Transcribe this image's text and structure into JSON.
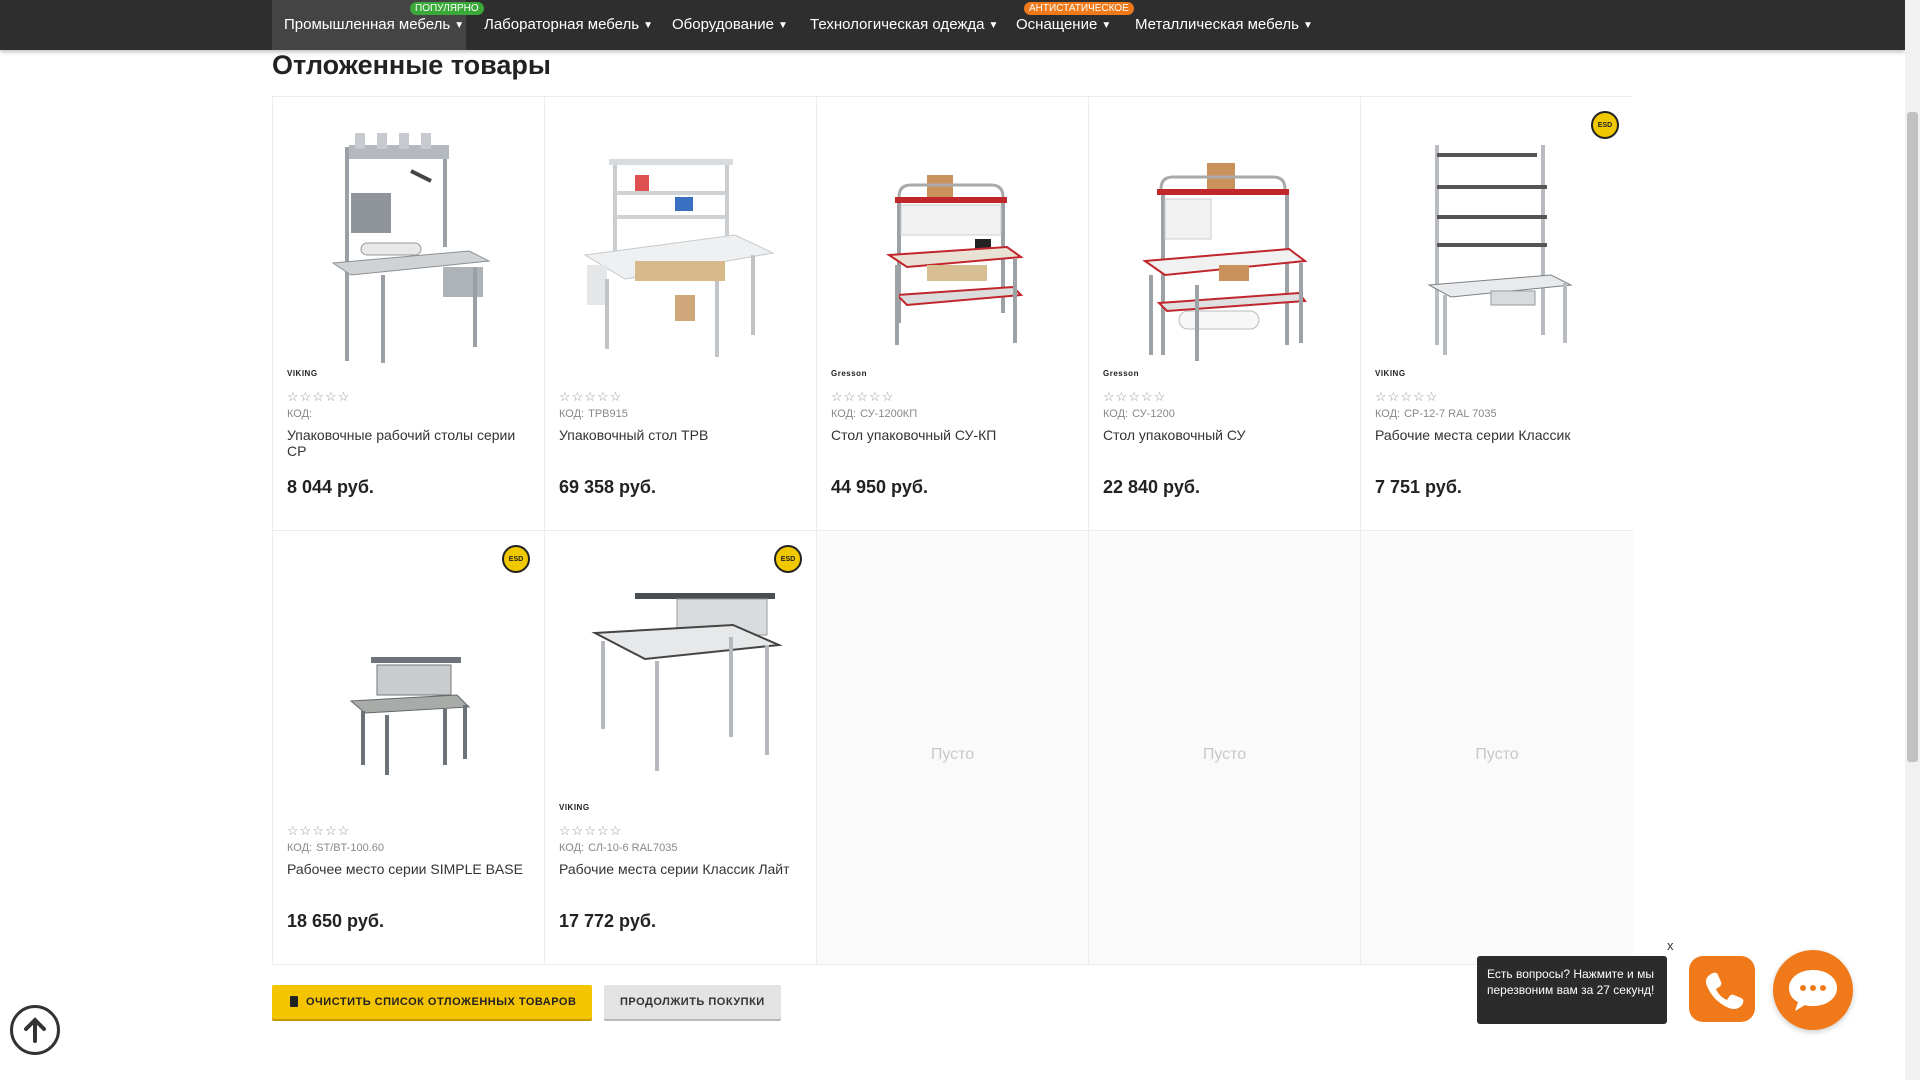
{
  "nav": {
    "items": [
      {
        "label": "Промышленная мебель",
        "badge": "ПОПУЛЯРНО",
        "badge_color": "#3aa93a"
      },
      {
        "label": "Лабораторная мебель",
        "badge": "",
        "badge_color": ""
      },
      {
        "label": "Оборудование",
        "badge": "",
        "badge_color": ""
      },
      {
        "label": "Технологическая одежда",
        "badge": "",
        "badge_color": ""
      },
      {
        "label": "Оснащение",
        "badge": "АНТИСТАТИЧЕСКОЕ",
        "badge_color": "#f07a1a"
      },
      {
        "label": "Металлическая мебель",
        "badge": "",
        "badge_color": ""
      }
    ]
  },
  "page": {
    "title": "Отложенные товары"
  },
  "products": [
    {
      "brand": "VIKING",
      "code_label": "КОД:",
      "code": "",
      "name": "Упаковочные рабочий столы серии СР",
      "price": "8 044 руб.",
      "esd": false,
      "stars": "☆☆☆☆☆"
    },
    {
      "brand": "",
      "code_label": "КОД:",
      "code": "TPB915",
      "name": "Упаковочный стол ТРВ",
      "price": "69 358 руб.",
      "esd": false,
      "stars": "☆☆☆☆☆"
    },
    {
      "brand": "Gresson",
      "code_label": "КОД:",
      "code": "СУ-1200КП",
      "name": "Стол упаковочный СУ-КП",
      "price": "44 950 руб.",
      "esd": false,
      "stars": "☆☆☆☆☆"
    },
    {
      "brand": "Gresson",
      "code_label": "КОД:",
      "code": "СУ-1200",
      "name": "Стол упаковочный СУ",
      "price": "22 840 руб.",
      "esd": false,
      "stars": "☆☆☆☆☆"
    },
    {
      "brand": "VIKING",
      "code_label": "КОД:",
      "code": "СР-12-7 RAL 7035",
      "name": "Рабочие места серии Классик",
      "price": "7 751 руб.",
      "esd": true,
      "stars": "☆☆☆☆☆"
    },
    {
      "brand": "",
      "code_label": "КОД:",
      "code": "ST/BT-100.60",
      "name": "Рабочее место серии SIMPLE BASE",
      "price": "18 650 руб.",
      "esd": true,
      "stars": "☆☆☆☆☆"
    },
    {
      "brand": "VIKING",
      "code_label": "КОД:",
      "code": "СЛ-10-6 RAL7035",
      "name": "Рабочие места серии Классик Лайт",
      "price": "17 772 руб.",
      "esd": true,
      "stars": "☆☆☆☆☆"
    }
  ],
  "empty_slots": [
    "Пусто",
    "Пусто",
    "Пусто"
  ],
  "esd_badge_label": "ESD",
  "buttons": {
    "clear": "Очистить список отложенных товаров",
    "continue": "Продолжить покупки"
  },
  "callback": {
    "tooltip": "Есть вопросы? Нажмите и мы перезвоним вам за 27 секунд!",
    "close": "x"
  },
  "icons": {
    "scroll_up": "arrow-up-circle-icon",
    "phone": "phone-icon",
    "chat": "chat-bubble-icon",
    "trash": "trash-icon"
  },
  "colors": {
    "nav_bg": "#2e2e2e",
    "accent_yellow": "#f5c400",
    "accent_orange": "#f07a1a",
    "popular_green": "#3aa93a"
  }
}
